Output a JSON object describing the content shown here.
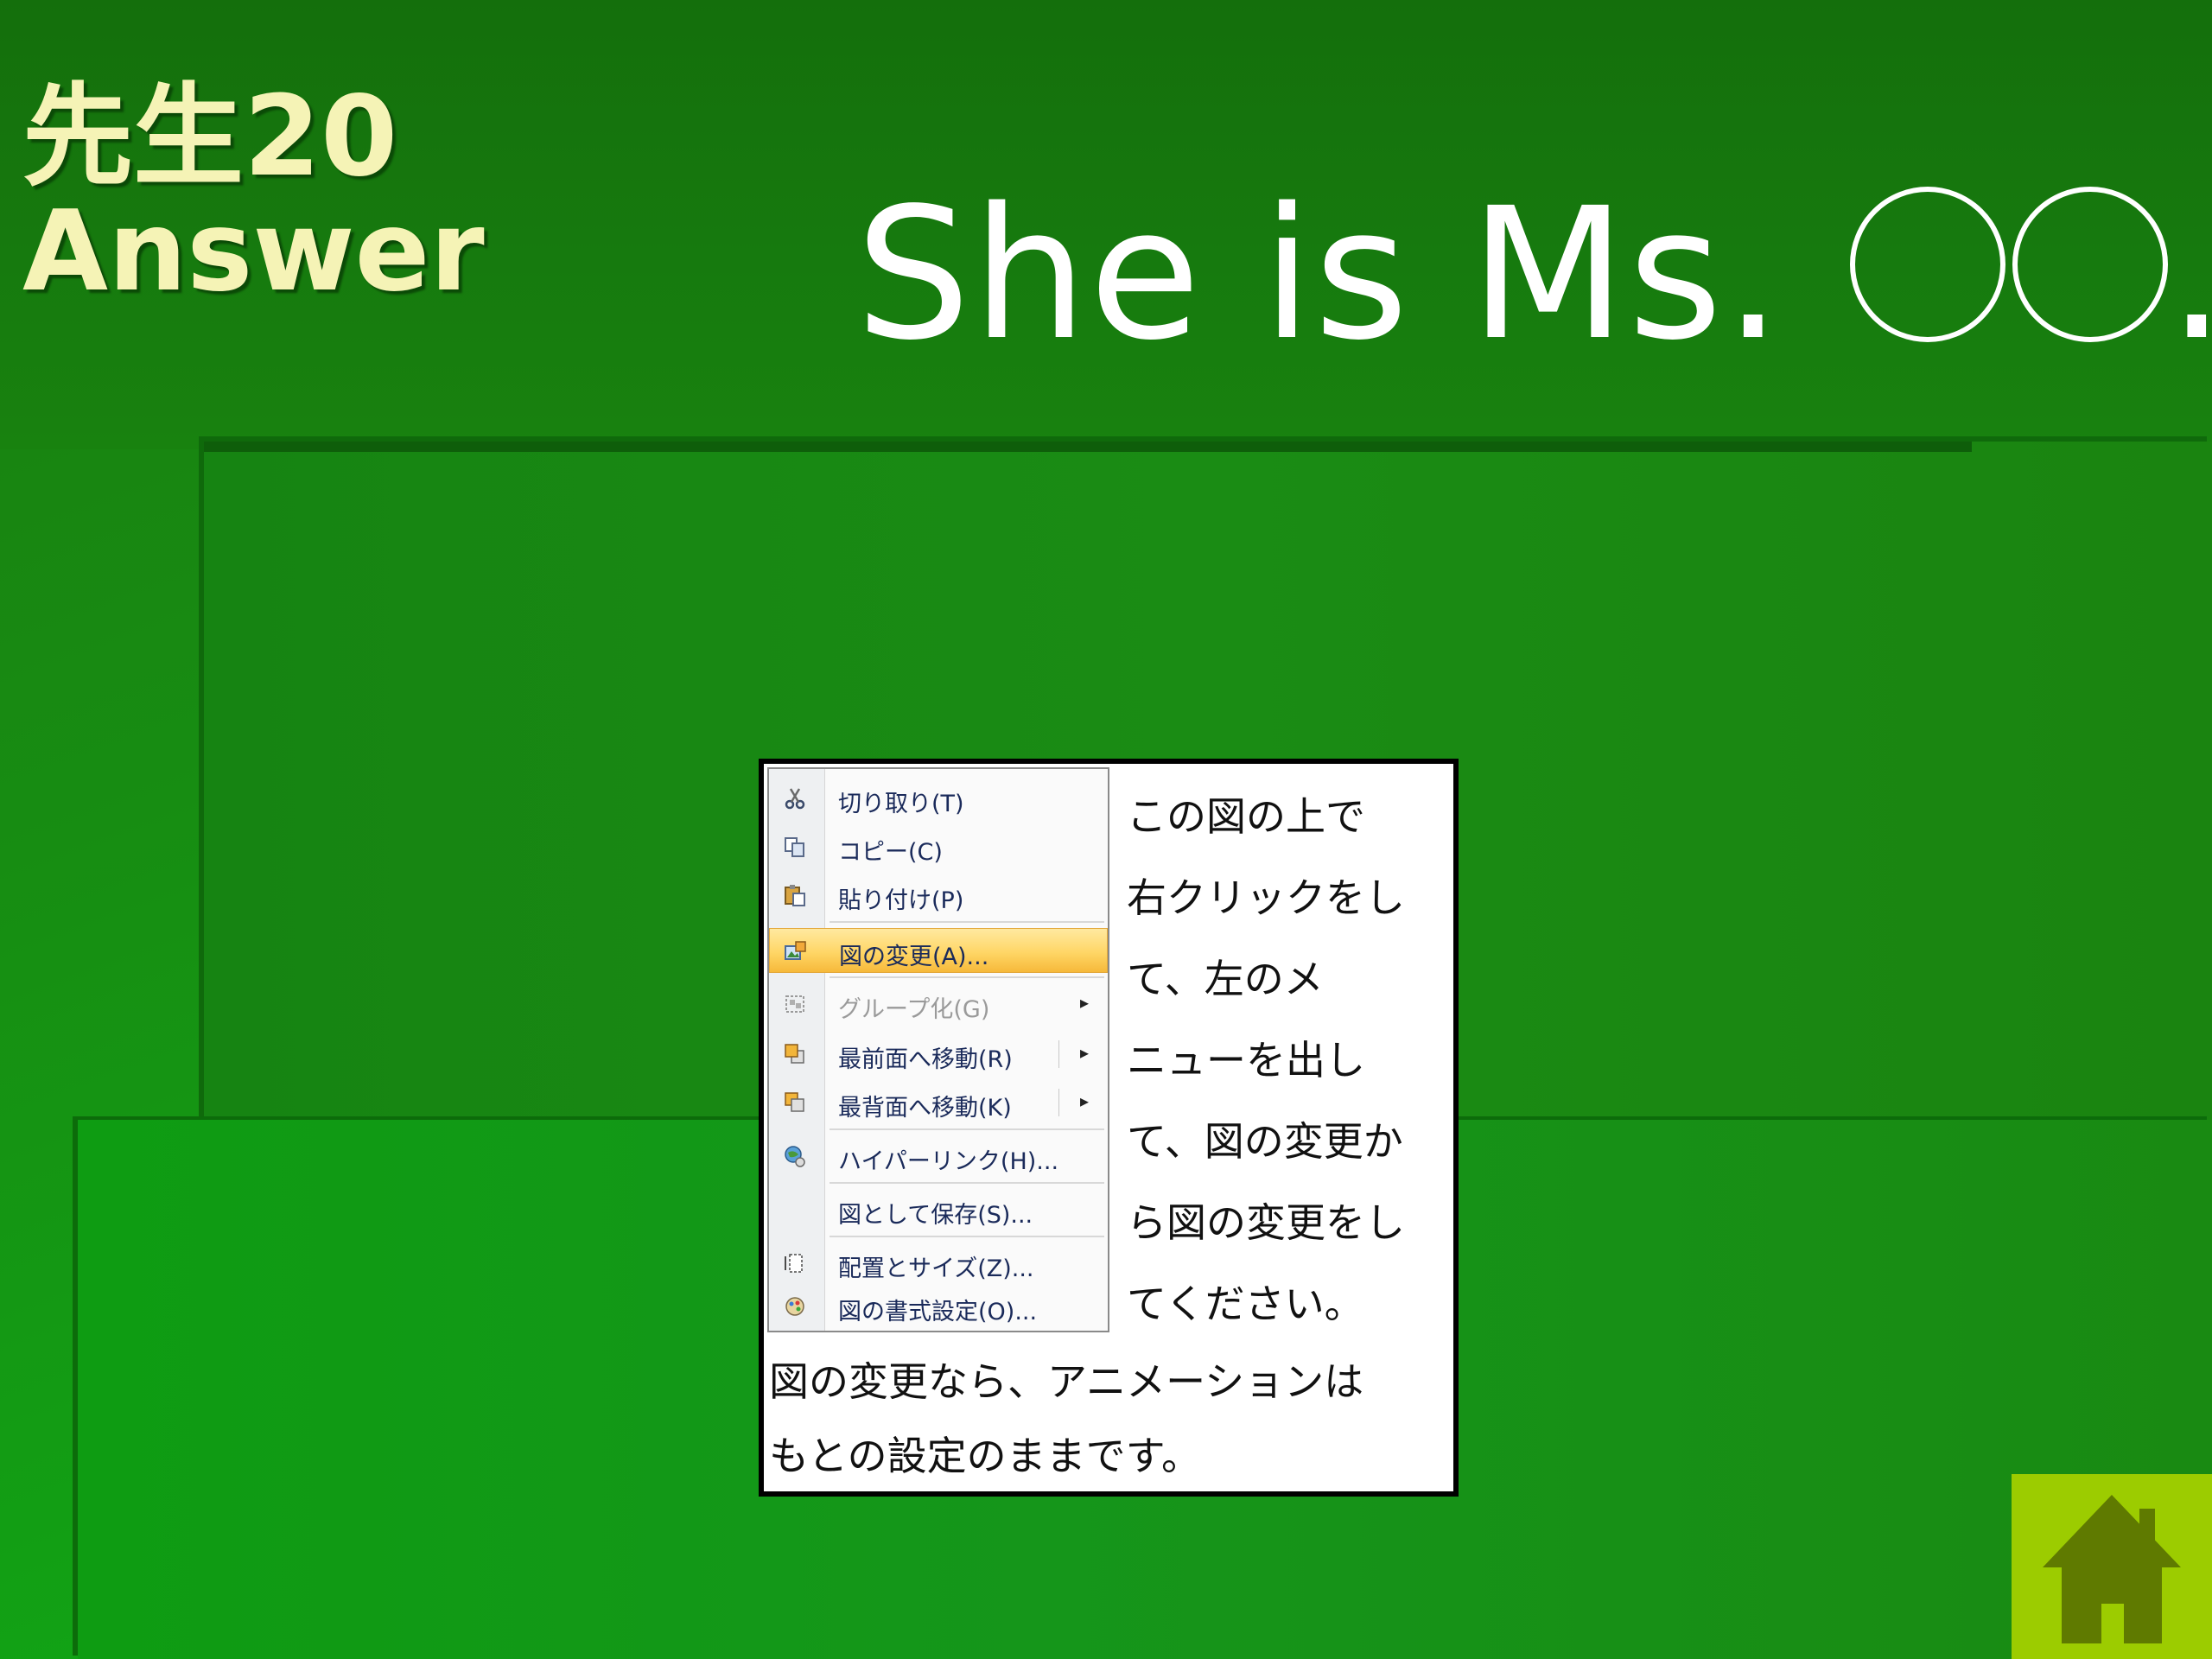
{
  "slide": {
    "title_line1": "先生20",
    "title_line2": "Answer",
    "heading_text": "She is Ms. ",
    "heading_suffix": "."
  },
  "context_menu": {
    "items": [
      {
        "label": "切り取り(T)",
        "icon": "scissors-icon"
      },
      {
        "label": "コピー(C)",
        "icon": "copy-icon"
      },
      {
        "label": "貼り付け(P)",
        "icon": "paste-icon"
      },
      {
        "label": "図の変更(A)...",
        "icon": "change-picture-icon"
      },
      {
        "label": "グループ化(G)",
        "icon": "group-icon"
      },
      {
        "label": "最前面へ移動(R)",
        "icon": "bring-to-front-icon"
      },
      {
        "label": "最背面へ移動(K)",
        "icon": "send-to-back-icon"
      },
      {
        "label": "ハイパーリンク(H)...",
        "icon": "hyperlink-icon"
      },
      {
        "label": "図として保存(S)...",
        "icon": ""
      },
      {
        "label": "配置とサイズ(Z)...",
        "icon": "size-position-icon"
      },
      {
        "label": "図の書式設定(O)...",
        "icon": "format-picture-icon"
      }
    ],
    "highlighted_index": 3,
    "disabled_index": 4
  },
  "instructions": {
    "side_lines": [
      "この図の上で",
      "右クリックをし",
      "て、左のメ",
      "ニューを出し",
      "て、図の変更か",
      "ら図の変更をし",
      "てください。"
    ],
    "bottom_lines": [
      "図の変更なら、アニメーションは",
      "もとの設定のままです。"
    ]
  },
  "colors": {
    "background": "#178d12",
    "title": "#f5f3b6",
    "heading": "#ffffff",
    "home_button": "#9ccc00",
    "home_icon": "#5f7a00",
    "menu_highlight": "#ffd666"
  }
}
